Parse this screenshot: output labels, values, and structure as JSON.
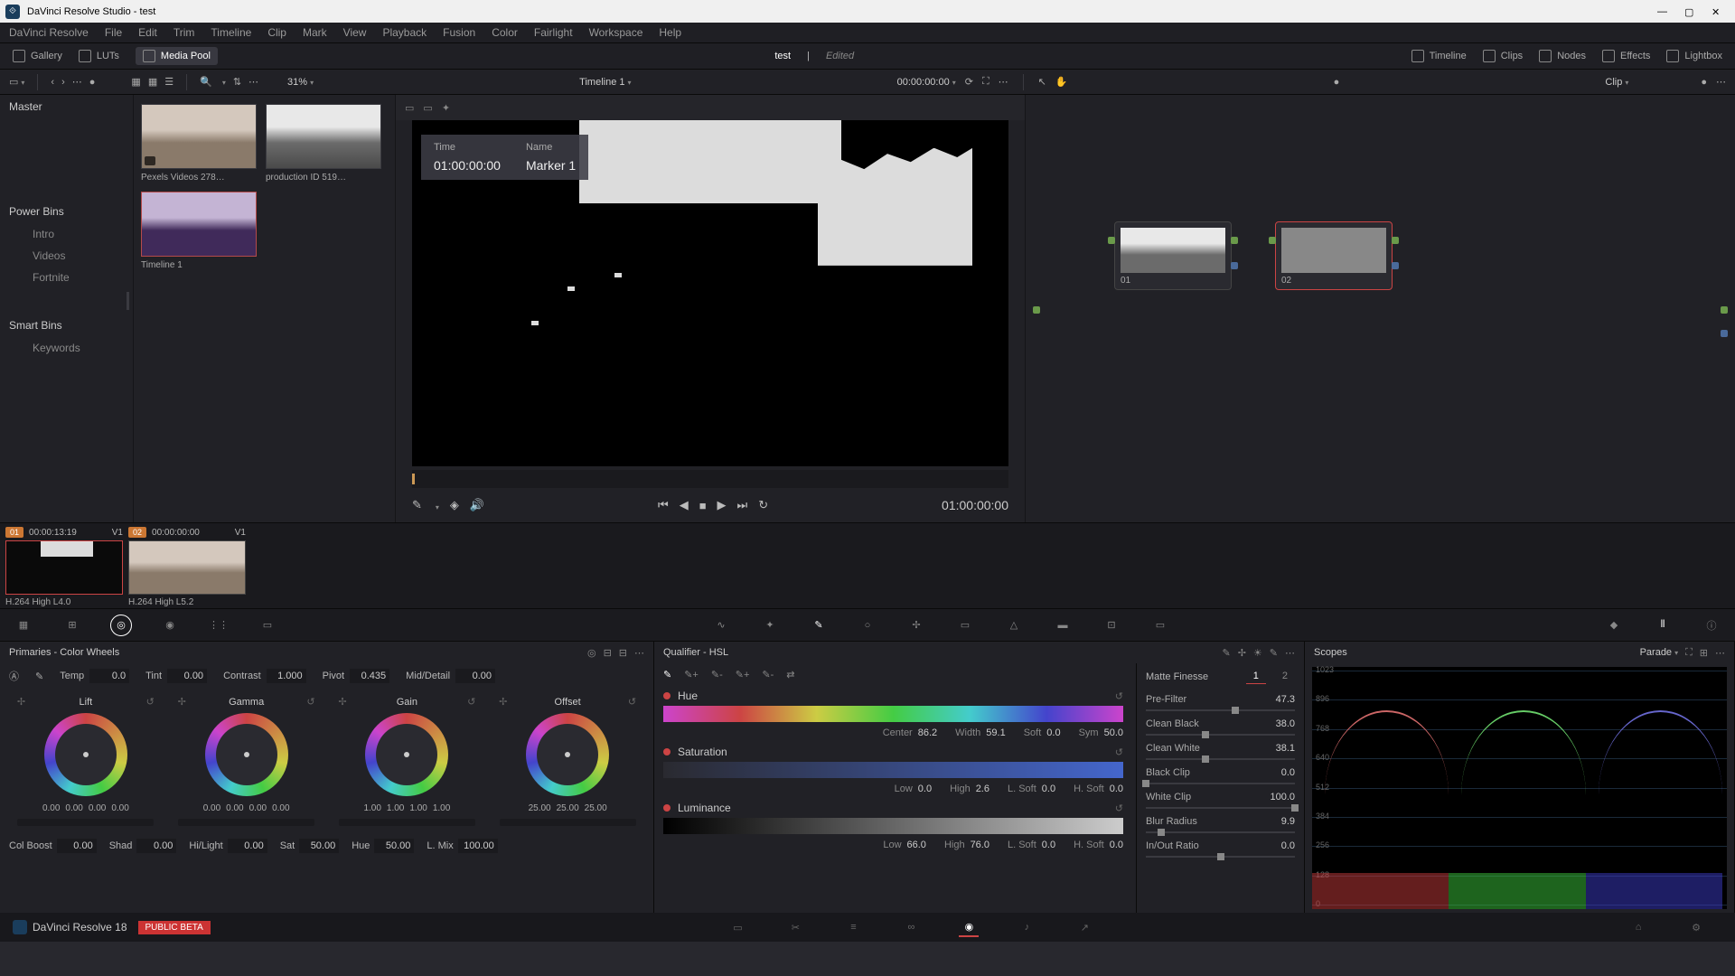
{
  "window": {
    "title": "DaVinci Resolve Studio - test"
  },
  "menu": [
    "DaVinci Resolve",
    "File",
    "Edit",
    "Trim",
    "Timeline",
    "Clip",
    "Mark",
    "View",
    "Playback",
    "Fusion",
    "Color",
    "Fairlight",
    "Workspace",
    "Help"
  ],
  "toptoolbar": {
    "gallery": "Gallery",
    "luts": "LUTs",
    "media_pool": "Media Pool",
    "project": "test",
    "edited": "Edited",
    "timeline": "Timeline",
    "clips": "Clips",
    "nodes": "Nodes",
    "effects": "Effects",
    "lightbox": "Lightbox"
  },
  "subtoolbar": {
    "zoom": "31%",
    "timeline_name": "Timeline 1",
    "timecode": "00:00:00:00",
    "clip_label": "Clip"
  },
  "media_pool": {
    "master": "Master",
    "thumbs": [
      {
        "label": "Pexels Videos 278…"
      },
      {
        "label": "production ID 519…"
      },
      {
        "label": "Timeline 1"
      }
    ],
    "power_bins": "Power Bins",
    "bins": [
      "Intro",
      "Videos",
      "Fortnite"
    ],
    "smart_bins": "Smart Bins",
    "keywords": "Keywords"
  },
  "viewer": {
    "marker_time_label": "Time",
    "marker_time_value": "01:00:00:00",
    "marker_name_label": "Name",
    "marker_name_value": "Marker 1",
    "tc": "01:00:00:00"
  },
  "nodes": {
    "n1": "01",
    "n2": "02"
  },
  "clip_strip": [
    {
      "num": "01",
      "tc": "00:00:13:19",
      "track": "V1",
      "codec": "H.264 High L4.0"
    },
    {
      "num": "02",
      "tc": "00:00:00:00",
      "track": "V1",
      "codec": "H.264 High L5.2"
    }
  ],
  "primaries": {
    "title": "Primaries - Color Wheels",
    "temp_l": "Temp",
    "temp": "0.0",
    "tint_l": "Tint",
    "tint": "0.00",
    "contrast_l": "Contrast",
    "contrast": "1.000",
    "pivot_l": "Pivot",
    "pivot": "0.435",
    "mid_l": "Mid/Detail",
    "mid": "0.00",
    "wheels": {
      "lift": {
        "name": "Lift",
        "vals": [
          "0.00",
          "0.00",
          "0.00",
          "0.00"
        ]
      },
      "gamma": {
        "name": "Gamma",
        "vals": [
          "0.00",
          "0.00",
          "0.00",
          "0.00"
        ]
      },
      "gain": {
        "name": "Gain",
        "vals": [
          "1.00",
          "1.00",
          "1.00",
          "1.00"
        ]
      },
      "offset": {
        "name": "Offset",
        "vals": [
          "25.00",
          "25.00",
          "25.00"
        ]
      }
    },
    "colboost_l": "Col Boost",
    "colboost": "0.00",
    "shad_l": "Shad",
    "shad": "0.00",
    "hilight_l": "Hi/Light",
    "hilight": "0.00",
    "sat_l": "Sat",
    "sat": "50.00",
    "hue_l": "Hue",
    "hue": "50.00",
    "lmix_l": "L. Mix",
    "lmix": "100.00"
  },
  "qualifier": {
    "title": "Qualifier - HSL",
    "hue": {
      "name": "Hue",
      "center_l": "Center",
      "center": "86.2",
      "width_l": "Width",
      "width": "59.1",
      "soft_l": "Soft",
      "soft": "0.0",
      "sym_l": "Sym",
      "sym": "50.0"
    },
    "sat": {
      "name": "Saturation",
      "low_l": "Low",
      "low": "0.0",
      "high_l": "High",
      "high": "2.6",
      "lsoft_l": "L. Soft",
      "lsoft": "0.0",
      "hsoft_l": "H. Soft",
      "hsoft": "0.0"
    },
    "lum": {
      "name": "Luminance",
      "low_l": "Low",
      "low": "66.0",
      "high_l": "High",
      "high": "76.0",
      "lsoft_l": "L. Soft",
      "lsoft": "0.0",
      "hsoft_l": "H. Soft",
      "hsoft": "0.0"
    }
  },
  "matte_finesse": {
    "title": "Matte Finesse",
    "tab1": "1",
    "tab2": "2",
    "rows": [
      {
        "l": "Pre-Filter",
        "v": "47.3",
        "pos": 60
      },
      {
        "l": "Clean Black",
        "v": "38.0",
        "pos": 40
      },
      {
        "l": "Clean White",
        "v": "38.1",
        "pos": 40
      },
      {
        "l": "Black Clip",
        "v": "0.0",
        "pos": 0
      },
      {
        "l": "White Clip",
        "v": "100.0",
        "pos": 100
      },
      {
        "l": "Blur Radius",
        "v": "9.9",
        "pos": 10
      },
      {
        "l": "In/Out Ratio",
        "v": "0.0",
        "pos": 50
      }
    ]
  },
  "scopes": {
    "title": "Scopes",
    "mode": "Parade",
    "levels": [
      "1023",
      "896",
      "768",
      "640",
      "512",
      "384",
      "256",
      "128",
      "0"
    ]
  },
  "footer": {
    "brand": "DaVinci Resolve 18",
    "beta": "PUBLIC BETA"
  }
}
